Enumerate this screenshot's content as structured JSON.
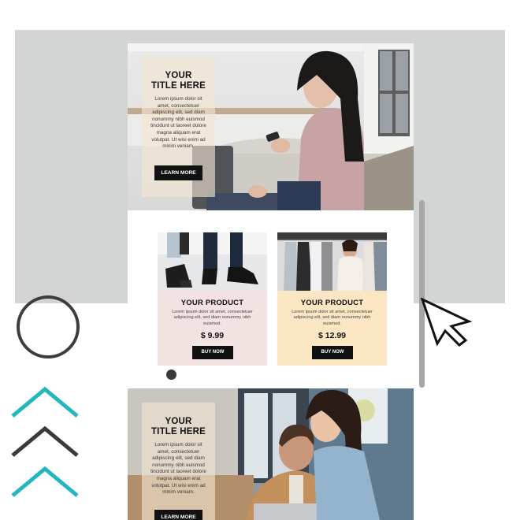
{
  "hero_top": {
    "title_line1": "YOUR",
    "title_line2": "TITLE HERE",
    "body": "Lorem ipsum dolor sit amet, consectetuer adipiscing elit, sed diam nonummy nibh euismod tincidunt ut laoreet dolore magna aliquam erat volutpat. Ut wisi enim ad minim veniam.",
    "button_label": "LEARN MORE"
  },
  "products": [
    {
      "title": "YOUR PRODUCT",
      "description": "Lorem ipsum dolor sit amet, consectetuer adipiscing elit, sed diam nonummy nibh euismod.",
      "price": "$ 9.99",
      "button_label": "BUY NOW",
      "background": "#f3e2e2"
    },
    {
      "title": "YOUR PRODUCT",
      "description": "Lorem ipsum dolor sit amet, consectetuer adipiscing elit, sed diam nonummy nibh euismod.",
      "price": "$ 12.99",
      "button_label": "BUY NOW",
      "background": "#fbe6c4"
    }
  ],
  "hero_bottom": {
    "title_line1": "YOUR",
    "title_line2": "TITLE HERE",
    "body": "Lorem ipsum dolor sit amet, consectetuer adipiscing elit, sed diam nonummy nibh euismod tincidunt ut laoreet dolore magna aliquam erat volutpat. Ut wisi enim ad minim veniam.",
    "button_label": "LEARN MORE"
  },
  "decor": {
    "icons": [
      "circle-outline-icon",
      "chevron-up-icon",
      "mouse-cursor-icon",
      "scrollbar",
      "dot-indicator"
    ],
    "chevron_colors": [
      "#23b6bd",
      "#3a3a3a",
      "#23b6bd"
    ],
    "accent_dark": "#111111",
    "backdrop_gray": "#d3d4d4"
  }
}
